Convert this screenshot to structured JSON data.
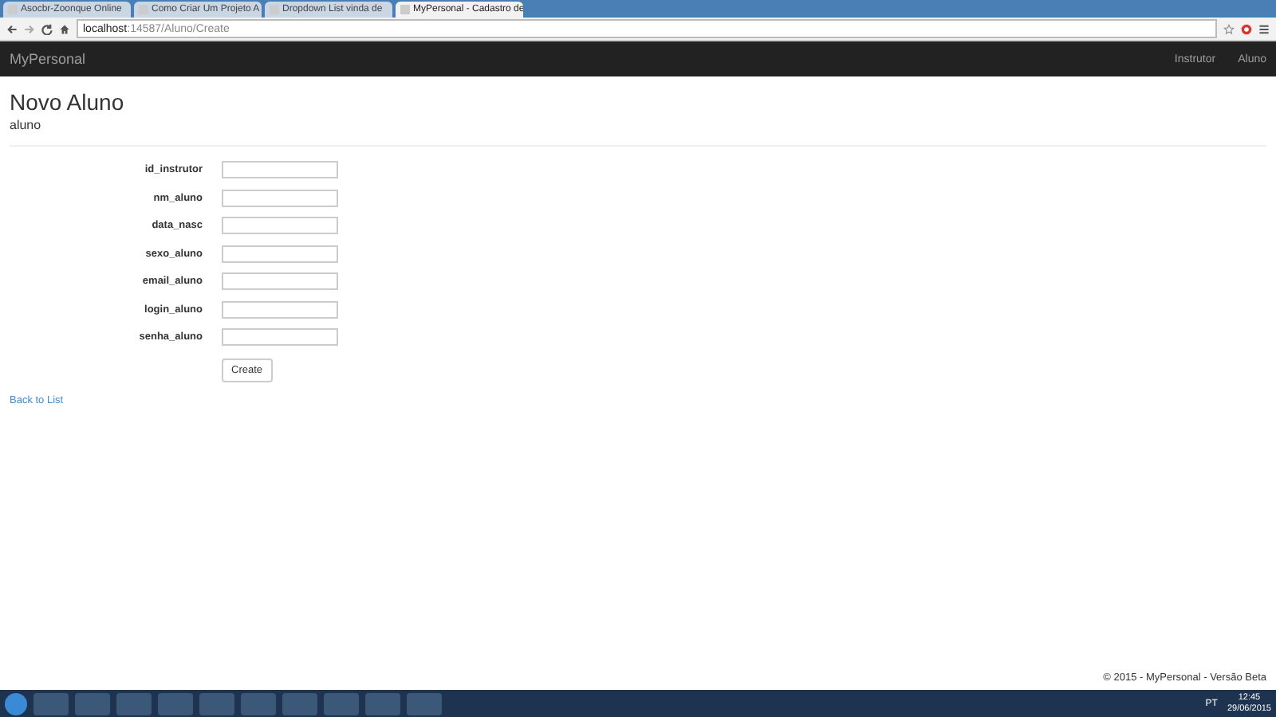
{
  "browser": {
    "tabs": [
      {
        "title": "Asocbr-Zoonque Online",
        "selected": false
      },
      {
        "title": "Como Criar Um Projeto A",
        "selected": false
      },
      {
        "title": "Dropdown List vinda de",
        "selected": false
      },
      {
        "title": "MyPersonal - Cadastro de",
        "selected": true
      }
    ],
    "url_host": "localhost",
    "url_path": ":14587/Aluno/Create"
  },
  "navbar": {
    "brand": "MyPersonal",
    "links": [
      "Instrutor",
      "Aluno"
    ]
  },
  "page": {
    "title": "Novo Aluno",
    "subtitle": "aluno",
    "fields": [
      {
        "label": "id_instrutor"
      },
      {
        "label": "nm_aluno"
      },
      {
        "label": "data_nasc"
      },
      {
        "label": "sexo_aluno"
      },
      {
        "label": "email_aluno"
      },
      {
        "label": "login_aluno"
      },
      {
        "label": "senha_aluno"
      }
    ],
    "submit": "Create",
    "back_link": "Back to List"
  },
  "footer": "© 2015 - MyPersonal - Versão Beta",
  "taskbar": {
    "language": "PT",
    "time": "12:45",
    "date": "29/06/2015"
  }
}
